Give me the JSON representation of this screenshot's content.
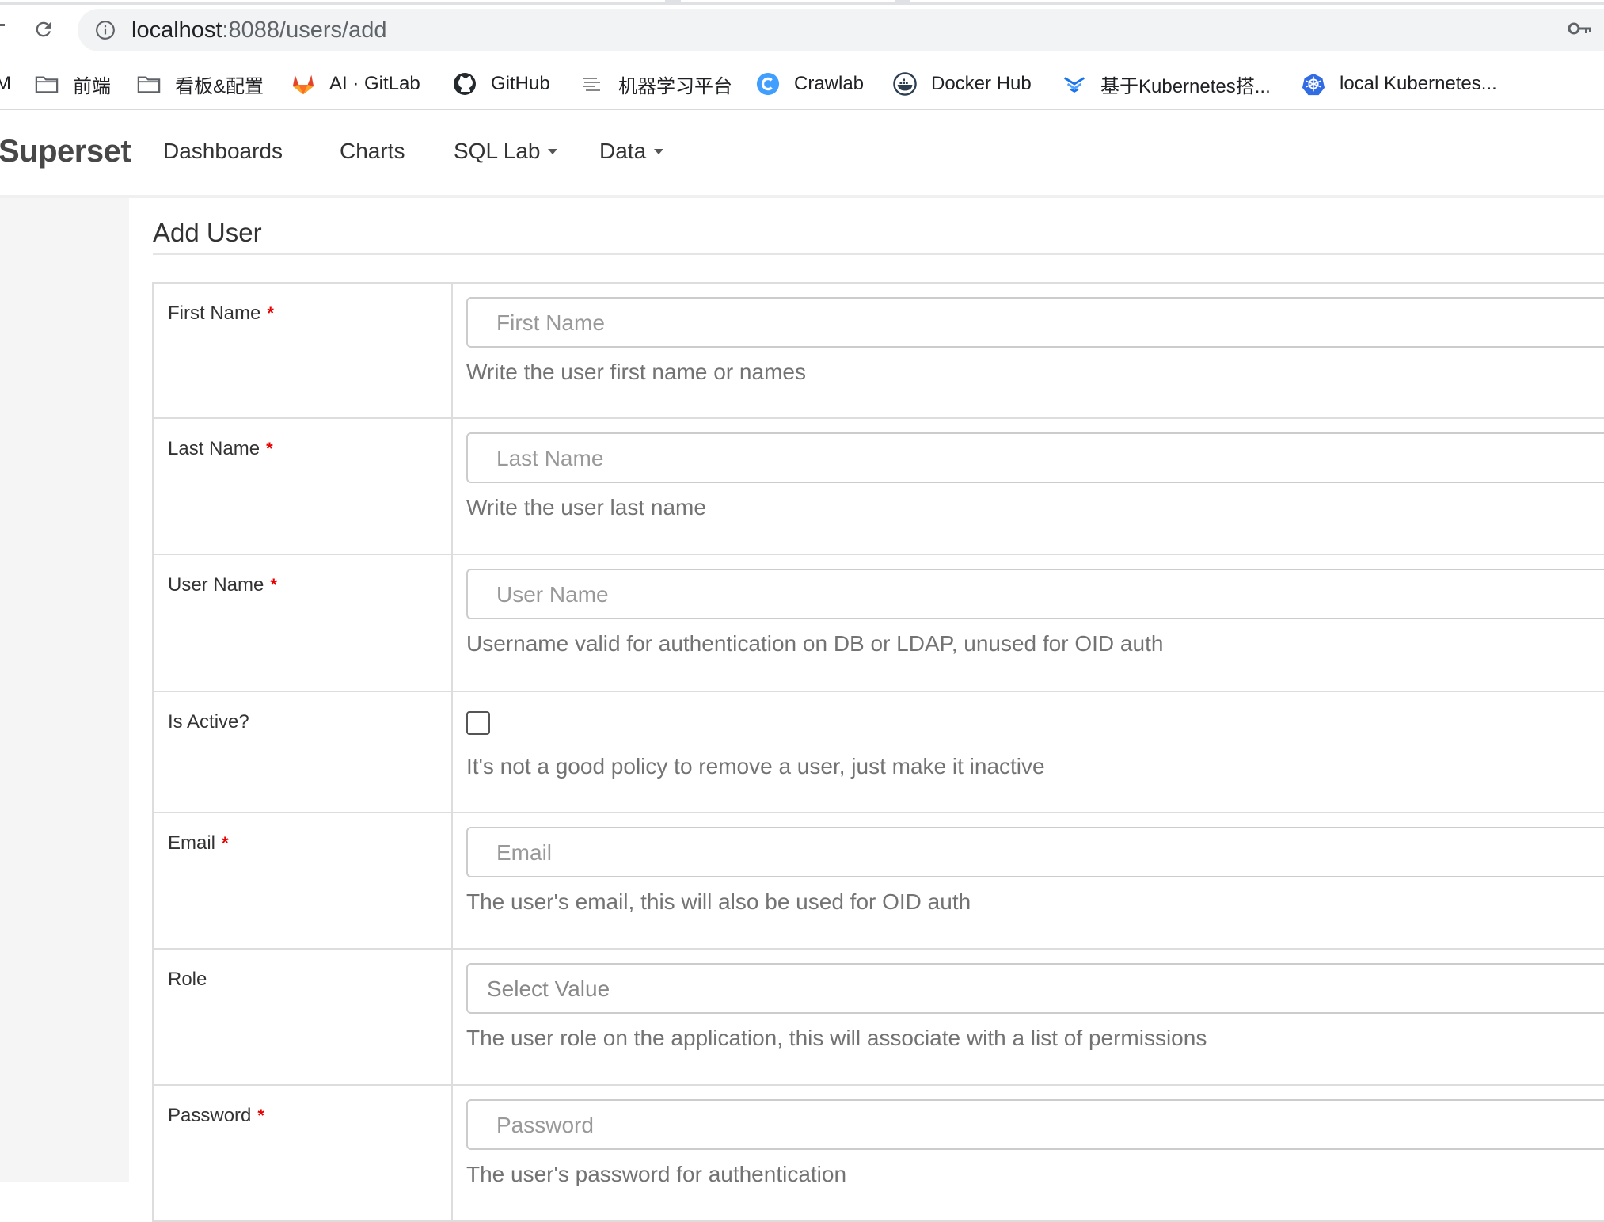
{
  "browser": {
    "url_host": "localhost",
    "url_path": ":8088/users/add",
    "bookmarks": [
      {
        "label": "M",
        "icon": "truncated"
      },
      {
        "label": "前端",
        "icon": "folder-icon"
      },
      {
        "label": "看板&配置",
        "icon": "folder-icon"
      },
      {
        "label": "AI · GitLab",
        "icon": "gitlab-icon"
      },
      {
        "label": "GitHub",
        "icon": "github-icon"
      },
      {
        "label": "机器学习平台",
        "icon": "ml-platform-icon"
      },
      {
        "label": "Crawlab",
        "icon": "crawlab-icon"
      },
      {
        "label": "Docker Hub",
        "icon": "docker-icon"
      },
      {
        "label": "基于Kubernetes搭...",
        "icon": "kube-stack-icon"
      },
      {
        "label": "local Kubernetes...",
        "icon": "kubernetes-icon"
      }
    ]
  },
  "navbar": {
    "brand": "Superset",
    "items": [
      {
        "label": "Dashboards",
        "dropdown": false
      },
      {
        "label": "Charts",
        "dropdown": false
      },
      {
        "label": "SQL Lab",
        "dropdown": true
      },
      {
        "label": "Data",
        "dropdown": true
      }
    ]
  },
  "page": {
    "title": "Add User"
  },
  "form": {
    "required_mark": "*",
    "fields": [
      {
        "label": "First Name",
        "placeholder": "First Name",
        "help": "Write the user first name or names"
      },
      {
        "label": "Last Name",
        "placeholder": "Last Name",
        "help": "Write the user last name"
      },
      {
        "label": "User Name",
        "placeholder": "User Name",
        "help": "Username valid for authentication on DB or LDAP, unused for OID auth"
      },
      {
        "label": "Is Active?",
        "checked": false,
        "help": "It's not a good policy to remove a user, just make it inactive"
      },
      {
        "label": "Email",
        "placeholder": "Email",
        "help": "The user's email, this will also be used for OID auth"
      },
      {
        "label": "Role",
        "placeholder": "Select Value",
        "help": "The user role on the application, this will associate with a list of permissions"
      },
      {
        "label": "Password",
        "placeholder": "Password",
        "help": "The user's password for authentication"
      }
    ]
  },
  "colors": {
    "required": "#e80000",
    "gitlab": "#e24329",
    "crawlab": "#409eff",
    "kubernetes": "#326ce5"
  }
}
